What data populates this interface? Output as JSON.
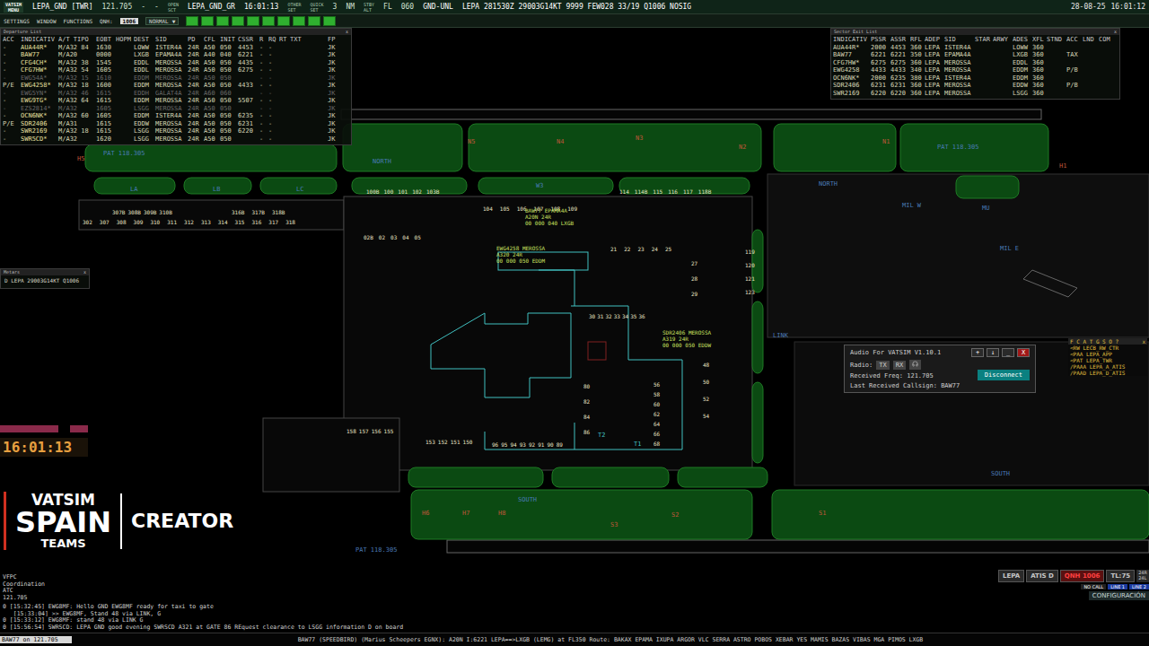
{
  "top_bar": {
    "logo": "VATSIM",
    "menu": "MENU",
    "position": "LEPA_GND [TWR]",
    "frequency": "121.705",
    "dashes": [
      "-",
      "-"
    ],
    "open_sct": [
      "OPEN",
      "SCT"
    ],
    "sector": "LEPA_GND_GR",
    "utc": "16:01:13",
    "sets": [
      [
        "OTHER",
        "SET"
      ],
      [
        "QUICK",
        "SET"
      ]
    ],
    "range": "3",
    "range_unit": "NM",
    "stby": [
      "STBY",
      "ALT"
    ],
    "fl_label": "FL",
    "fl": "060",
    "mode": "GND-UNL",
    "metar": "LEPA 281530Z 29003G14KT 9999 FEW028 33/19 Q1006 NOSIG",
    "date": "28-08-25",
    "time": "16:01:12"
  },
  "menu_bar": {
    "items": [
      "SETTINGS",
      "WINDOW",
      "FUNCTIONS"
    ],
    "qnh_label": "QNH:",
    "qnh": "1006",
    "profile": "NORMAL",
    "profile_arrow": "▼",
    "toggles": [
      {
        "on": true
      },
      {
        "on": true
      },
      {
        "on": true
      },
      {
        "on": true
      },
      {
        "on": true
      },
      {
        "on": true
      },
      {
        "on": true
      },
      {
        "on": true
      },
      {
        "on": true
      },
      {
        "on": true
      }
    ]
  },
  "departure_list": {
    "title": "Departure List",
    "close": "x",
    "columns": [
      "ACC",
      "INDICATIV",
      "A/T TIPO",
      "EOBT",
      "HOPM",
      "DEST",
      "SID",
      "PD",
      "CFL",
      "INIT",
      "CSSR",
      "R",
      "RQ",
      "RT",
      "TXT",
      "FP"
    ],
    "rows": [
      {
        "cells": [
          "-",
          "AUA44R*",
          "M/A32 84",
          "1630",
          "",
          "LOWW",
          "ISTER4A",
          "24R",
          "A50",
          "050",
          "4453",
          "-",
          "-",
          "",
          "",
          "JK"
        ],
        "dimmed": false
      },
      {
        "cells": [
          "-",
          "BAW77",
          "M/A20",
          "0000",
          "",
          "LXGB",
          "EPAMA4A",
          "24R",
          "A40",
          "040",
          "6221",
          "-",
          "-",
          "",
          "",
          "JK"
        ],
        "dimmed": false
      },
      {
        "cells": [
          "-",
          "CFG4CH*",
          "M/A32 38",
          "1545",
          "",
          "EDDL",
          "MEROSSA",
          "24R",
          "A50",
          "050",
          "4435",
          "-",
          "-",
          "",
          "",
          "JK"
        ],
        "dimmed": false
      },
      {
        "cells": [
          "-",
          "CFG7HW*",
          "M/A32 54",
          "1605",
          "",
          "EDDL",
          "MEROSSA",
          "24R",
          "A50",
          "050",
          "6275",
          "-",
          "-",
          "",
          "",
          "JK"
        ],
        "dimmed": false
      },
      {
        "cells": [
          "-",
          "EWG54A*",
          "M/A32 15",
          "1610",
          "",
          "EDDM",
          "MEROSSA",
          "24R",
          "A50",
          "050",
          "",
          "-",
          "-",
          "",
          "",
          "JK"
        ],
        "dimmed": true
      },
      {
        "cells": [
          "P/E",
          "EWG4258*",
          "M/A32 18",
          "1600",
          "",
          "EDDM",
          "MEROSSA",
          "24R",
          "A50",
          "050",
          "4433",
          "-",
          "-",
          "",
          "",
          "JK"
        ],
        "dimmed": false
      },
      {
        "cells": [
          "-",
          "EWG5YN*",
          "M/A32 46",
          "1615",
          "",
          "EDDH",
          "GALAT4A",
          "24R",
          "A60",
          "060",
          "",
          "-",
          "-",
          "",
          "",
          "JK"
        ],
        "dimmed": true
      },
      {
        "cells": [
          "-",
          "EWG9TG*",
          "M/A32 64",
          "1615",
          "",
          "EDDM",
          "MEROSSA",
          "24R",
          "A50",
          "050",
          "5507",
          "-",
          "-",
          "",
          "",
          "JK"
        ],
        "dimmed": false
      },
      {
        "cells": [
          "-",
          "EZS2814*",
          "M/A32",
          "1605",
          "",
          "LSGG",
          "MEROSSA",
          "24R",
          "A50",
          "050",
          "",
          "-",
          "-",
          "",
          "",
          "JK"
        ],
        "dimmed": true
      },
      {
        "cells": [
          "-",
          "OCN6NK*",
          "M/A32 60",
          "1605",
          "",
          "EDDM",
          "ISTER4A",
          "24R",
          "A50",
          "050",
          "6235",
          "-",
          "-",
          "",
          "",
          "JK"
        ],
        "dimmed": false
      },
      {
        "cells": [
          "P/E",
          "SDR2406",
          "M/A31",
          "1615",
          "",
          "EDDW",
          "MEROSSA",
          "24R",
          "A50",
          "050",
          "6231",
          "-",
          "-",
          "",
          "",
          "JK"
        ],
        "dimmed": false
      },
      {
        "cells": [
          "-",
          "SWR2169",
          "M/A32 18",
          "1615",
          "",
          "LSGG",
          "MEROSSA",
          "24R",
          "A50",
          "050",
          "6220",
          "-",
          "-",
          "",
          "",
          "JK"
        ],
        "dimmed": false
      },
      {
        "cells": [
          "-",
          "SWR5CD*",
          "M/A32",
          "1620",
          "",
          "LSGG",
          "MEROSSA",
          "24R",
          "A50",
          "050",
          "",
          "-",
          "-",
          "",
          "",
          "JK"
        ],
        "dimmed": false
      }
    ]
  },
  "sector_exit_list": {
    "title": "Sector Exit List",
    "close": "x",
    "columns": [
      "INDICATIV",
      "PSSR",
      "ASSR",
      "RFL",
      "ADEP",
      "SID",
      "STAR",
      "ARWY",
      "ADES",
      "XFL",
      "STND",
      "ACC",
      "LND",
      "COM"
    ],
    "rows": [
      {
        "cells": [
          "AUA44R*",
          "2000",
          "4453",
          "360",
          "LEPA",
          "ISTER4A",
          "",
          "",
          "LOWW",
          "360",
          "",
          "",
          "",
          ""
        ]
      },
      {
        "cells": [
          "BAW77",
          "6221",
          "6221",
          "350",
          "LEPA",
          "EPAMA4A",
          "",
          "",
          "LXGB",
          "360",
          "",
          "TAX",
          "",
          ""
        ]
      },
      {
        "cells": [
          "CFG7HW*",
          "6275",
          "6275",
          "360",
          "LEPA",
          "MEROSSA",
          "",
          "",
          "EDDL",
          "360",
          "",
          "",
          "",
          ""
        ]
      },
      {
        "cells": [
          "EWG4258",
          "4433",
          "4433",
          "340",
          "LEPA",
          "MEROSSA",
          "",
          "",
          "EDDM",
          "360",
          "",
          "P/B",
          "",
          ""
        ]
      },
      {
        "cells": [
          "OCN6NK*",
          "2000",
          "6235",
          "380",
          "LEPA",
          "ISTER4A",
          "",
          "",
          "EDDM",
          "360",
          "",
          "",
          "",
          ""
        ]
      },
      {
        "cells": [
          "SDR2406",
          "6231",
          "6231",
          "360",
          "LEPA",
          "MEROSSA",
          "",
          "",
          "EDDW",
          "360",
          "",
          "P/B",
          "",
          ""
        ]
      },
      {
        "cells": [
          "SWR2169",
          "6220",
          "6220",
          "360",
          "LEPA",
          "MEROSSA",
          "",
          "",
          "LSGG",
          "360",
          "",
          "",
          "",
          ""
        ]
      }
    ]
  },
  "metar_window": {
    "title": "Metars",
    "close": "x",
    "text": "D LEPA 29003G14KT Q1006"
  },
  "audio_window": {
    "title": "Audio For VATSIM V1.10.1",
    "controls": [
      "+",
      "↓",
      "_",
      "X"
    ],
    "radio_label": "Radio:",
    "tx": "TX",
    "rx": "RX",
    "disconnect": "Disconnect",
    "received_freq": "Received Freq: 121.705",
    "last_callsign": "Last Received Callsign: BAW77"
  },
  "controller_list": {
    "title": "F C A T G S O ?",
    "close": "x",
    "entries": [
      "<RW LECB_RW_CTR",
      "<PAA LEPA_APP",
      "<PAT LEPA_TWR",
      "/PAAA LEPA_A_ATIS",
      "/PAAD LEPA_D_ATIS"
    ]
  },
  "map_labels": [
    {
      "text": "H5",
      "kind": "taxiway"
    },
    {
      "text": "N5",
      "kind": "taxiway"
    },
    {
      "text": "N4",
      "kind": "taxiway"
    },
    {
      "text": "N3",
      "kind": "taxiway"
    },
    {
      "text": "N2",
      "kind": "taxiway"
    },
    {
      "text": "N1",
      "kind": "taxiway"
    },
    {
      "text": "H1",
      "kind": "taxiway"
    },
    {
      "text": "LA",
      "kind": "area"
    },
    {
      "text": "LB",
      "kind": "area"
    },
    {
      "text": "LC",
      "kind": "area"
    },
    {
      "text": "W3",
      "kind": "area"
    },
    {
      "text": "NORTH",
      "kind": "area"
    },
    {
      "text": "NORTH",
      "kind": "area"
    },
    {
      "text": "PAT 118.305",
      "kind": "area"
    },
    {
      "text": "PAT 118.305",
      "kind": "area"
    },
    {
      "text": "PAT 118.305",
      "kind": "area"
    },
    {
      "text": "LINK",
      "kind": "area"
    },
    {
      "text": "MIL W",
      "kind": "area"
    },
    {
      "text": "MU",
      "kind": "area"
    },
    {
      "text": "MIL E",
      "kind": "area"
    },
    {
      "text": "SOUTH",
      "kind": "area"
    },
    {
      "text": "SOUTH",
      "kind": "area"
    },
    {
      "text": "H6",
      "kind": "taxiway"
    },
    {
      "text": "H7",
      "kind": "taxiway"
    },
    {
      "text": "H8",
      "kind": "taxiway"
    },
    {
      "text": "S3",
      "kind": "taxiway"
    },
    {
      "text": "S2",
      "kind": "taxiway"
    },
    {
      "text": "S1",
      "kind": "taxiway"
    },
    {
      "text": "T2",
      "kind": "terminal"
    },
    {
      "text": "T1",
      "kind": "terminal"
    }
  ],
  "stand_groups": [
    {
      "labels": [
        "100B",
        "100",
        "101",
        "102",
        "103B"
      ]
    },
    {
      "labels": [
        "104",
        "105",
        "106",
        "107",
        "108",
        "109"
      ]
    },
    {
      "labels": [
        "114",
        "114B",
        "115",
        "116",
        "117",
        "118B"
      ]
    },
    {
      "labels": [
        "302",
        "307",
        "308",
        "309",
        "310",
        "311",
        "312",
        "313",
        "314",
        "315",
        "316",
        "317",
        "318"
      ]
    },
    {
      "labels": [
        "307B",
        "308B",
        "309B",
        "310B"
      ]
    },
    {
      "labels": [
        "316B",
        "317B",
        "318B"
      ]
    },
    {
      "labels": [
        "02B",
        "02",
        "03",
        "04",
        "05"
      ]
    },
    {
      "labels": [
        "21",
        "22",
        "23",
        "24",
        "25"
      ]
    },
    {
      "labels": [
        "27",
        "28",
        "29"
      ]
    },
    {
      "labels": [
        "119",
        "120",
        "121",
        "123"
      ]
    },
    {
      "labels": [
        "30",
        "31",
        "32",
        "33",
        "34",
        "35",
        "36"
      ]
    },
    {
      "labels": [
        "48",
        "50",
        "52",
        "54"
      ]
    },
    {
      "labels": [
        "56",
        "58",
        "60",
        "62",
        "64",
        "66",
        "68"
      ]
    },
    {
      "labels": [
        "80",
        "82",
        "84",
        "86"
      ]
    },
    {
      "labels": [
        "158",
        "157",
        "156",
        "155"
      ]
    },
    {
      "labels": [
        "153",
        "152",
        "151",
        "150"
      ]
    },
    {
      "labels": [
        "96",
        "95",
        "94",
        "93",
        "92",
        "91",
        "90",
        "89"
      ]
    }
  ],
  "flight_tags": [
    {
      "lines": [
        "BAW77 EPAMA4A",
        "A20N 24R",
        "00 000 040 LXGB"
      ]
    },
    {
      "lines": [
        "EWG4258 MEROSSA",
        "A320 24R",
        "00 000 050 EDDM"
      ]
    },
    {
      "lines": [
        "SDR2406 MEROSSA",
        "A319 24R",
        "00 000 050 EDDW"
      ]
    }
  ],
  "clock": "16:01:13",
  "logo": {
    "vatsim": "VATSIM",
    "spain": "SPAIN",
    "teams": "TEAMS",
    "creator": "CREATOR"
  },
  "chat": {
    "channels": [
      "VFPC",
      "Coordination",
      "ATC",
      "121.705"
    ],
    "messages": [
      "0 [15:32:45] EWG8MF: Hello GND EWG8MF ready for taxi to gate",
      "   [15:33:04] >> EWG8MF, Stand 48 via LINK, G",
      "0 [15:33:12] EWG8MF: stand 48 via LINK G",
      "0 [15:56:54] SWRSCD: LEPA GND good evening SWRSCD A321 at GATE 86 REquest clearance to LSGG information D on board"
    ]
  },
  "input": "BAW77 on 121.705",
  "status_line": "BAW77 (SPEEDBIRD) (Marius Scheepers EGNX): A20N I:6221 LEPA==>LXGB (LEMG) at FL350 Route: BAKAX EPAMA IXUPA ARGOR VLC SERRA ASTRO POBOS XEBAR YES MAMIS BAZAS VIBAS MGA PIMOS LXGB",
  "atis_panel": {
    "airport": "LEPA",
    "atis": "ATIS D",
    "qnh": "QNH 1006",
    "tl": "TL:75",
    "runways": [
      "24R",
      "24L"
    ],
    "lines": [
      "NO CALL",
      "LINE 1",
      "LINE 2"
    ],
    "config": "CONFIGURACIÓN"
  }
}
